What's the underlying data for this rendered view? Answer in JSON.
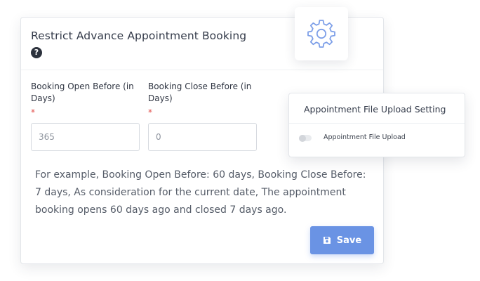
{
  "restrict_card": {
    "title": "Restrict Advance Appointment Booking",
    "help_glyph": "?",
    "open_before": {
      "label": "Booking Open Before (in Days)",
      "required_mark": "*",
      "value": "365"
    },
    "close_before": {
      "label": "Booking Close Before (in Days)",
      "required_mark": "*",
      "value": "0"
    },
    "info_text": "For example, Booking Open Before: 60 days, Booking Close Before: 7 days, As consideration for the current date, The appointment booking opens 60 days ago and closed 7 days ago.",
    "save_label": "Save"
  },
  "settings_tile": {
    "icon": "gear-icon"
  },
  "upload_card": {
    "title": "Appointment File Upload Setting",
    "toggle_label": "Appointment File Upload",
    "toggle_on": false
  },
  "colors": {
    "accent": "#6a93e4",
    "gear": "#7d9fe8",
    "required": "#e2504c"
  }
}
